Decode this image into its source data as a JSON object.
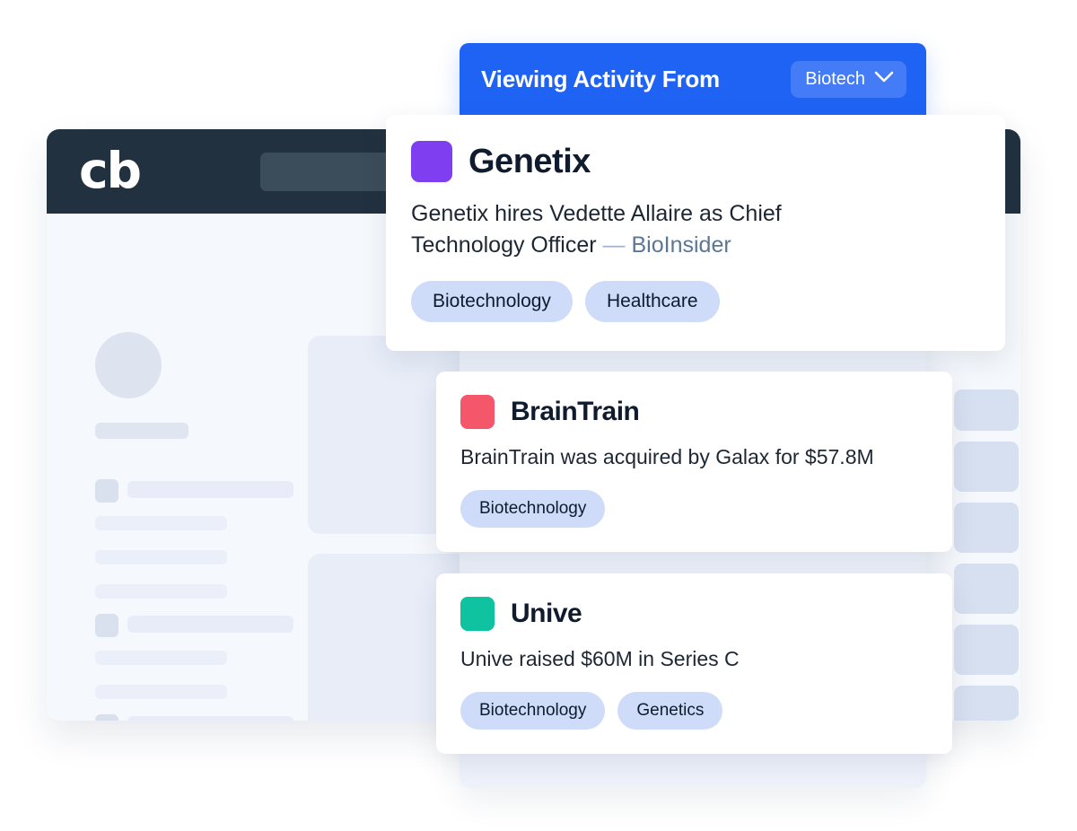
{
  "banner": {
    "title": "Viewing Activity From",
    "filter_label": "Biotech",
    "filter_icon": "chevron-down-icon",
    "bg_color": "#1f63f5"
  },
  "app_window": {
    "logo_text": "cb",
    "header_bg": "#22313f",
    "body_bg": "#f5f8fc"
  },
  "feed": {
    "cards": [
      {
        "company": "Genetix",
        "swatch_color": "#7f3ef0",
        "description": "Genetix hires Vedette Allaire as Chief Technology Officer",
        "separator": "—",
        "source": "BioInsider",
        "tags": [
          "Biotechnology",
          "Healthcare"
        ]
      },
      {
        "company": "BrainTrain",
        "swatch_color": "#f4566a",
        "description": "BrainTrain was acquired by Galax for $57.8M",
        "separator": "",
        "source": "",
        "tags": [
          "Biotechnology"
        ]
      },
      {
        "company": "Unive",
        "swatch_color": "#10c3a0",
        "description": "Unive raised $60M in Series C",
        "separator": "",
        "source": "",
        "tags": [
          "Biotechnology",
          "Genetics"
        ]
      }
    ]
  },
  "colors": {
    "accent_blue": "#1f63f5",
    "tag_bg": "#cfdcf9",
    "dark_navy": "#22313f",
    "skeleton": "#e6ebf5"
  }
}
